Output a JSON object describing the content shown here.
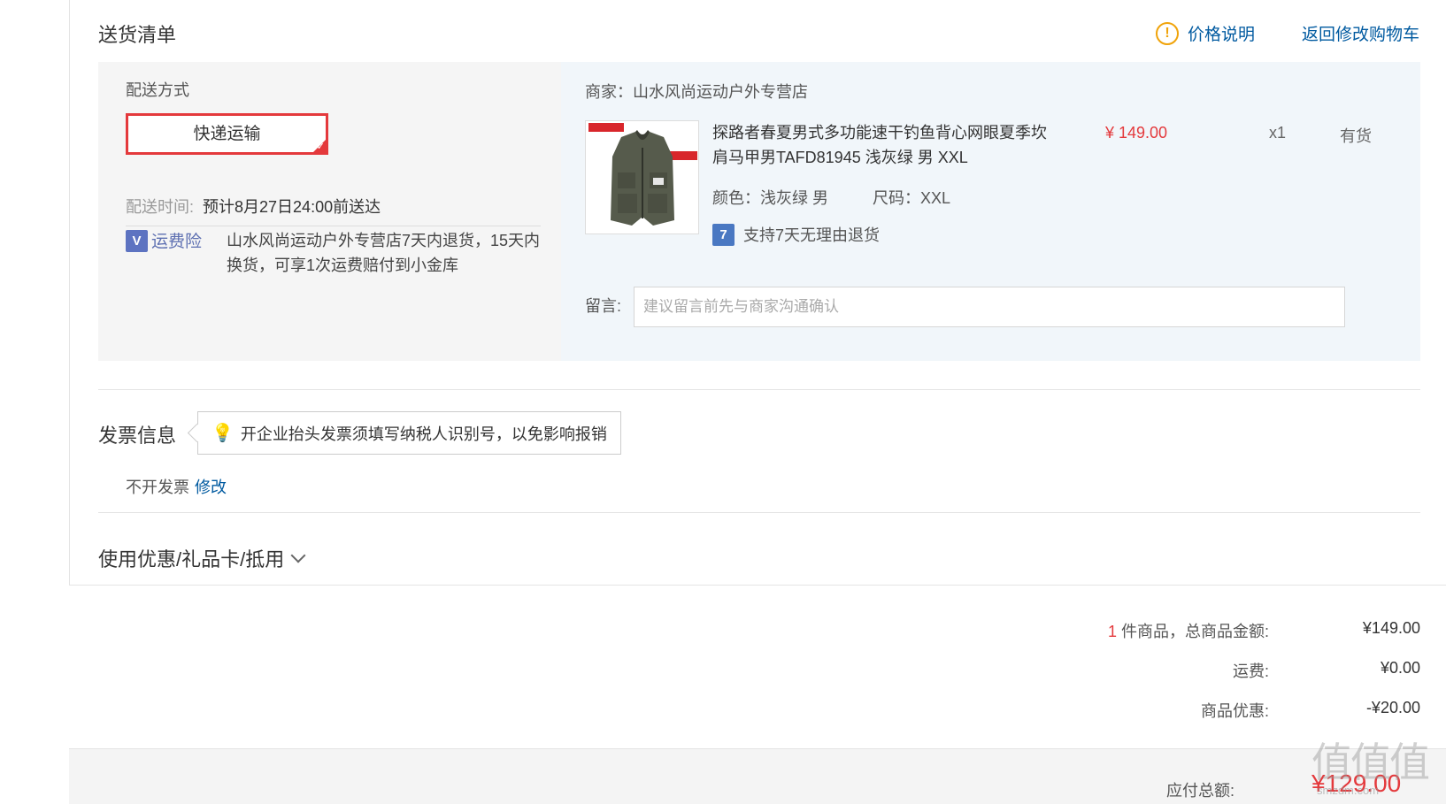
{
  "header": {
    "title": "送货清单",
    "price_note": "价格说明",
    "back_cart": "返回修改购物车"
  },
  "delivery": {
    "method_label": "配送方式",
    "method_selected": "快递运输",
    "time_label": "配送时间:",
    "time_value": "预计8月27日24:00前送达",
    "insurance_label": "运费险",
    "insurance_text": "山水风尚运动户外专营店7天内退货，15天内换货，可享1次运费赔付到小金库"
  },
  "shop": {
    "merchant": "商家：山水风尚运动户外专营店",
    "product": {
      "title": "探路者春夏男式多功能速干钓鱼背心网眼夏季坎肩马甲男TAFD81945 浅灰绿 男 XXL",
      "price": "¥ 149.00",
      "qty": "x1",
      "stock": "有货",
      "color": "颜色：浅灰绿 男",
      "size": "尺码：XXL",
      "return_policy": "支持7天无理由退货"
    },
    "message_label": "留言:",
    "message_placeholder": "建议留言前先与商家沟通确认",
    "message_value": ""
  },
  "invoice": {
    "title": "发票信息",
    "tip": "开企业抬头发票须填写纳税人识别号，以免影响报销",
    "status": "不开发票",
    "edit": "修改"
  },
  "coupon": {
    "label": "使用优惠/礼品卡/抵用"
  },
  "summary": {
    "count": "1",
    "goods_label": "件商品，总商品金额:",
    "goods_value": "¥149.00",
    "shipping_label": "运费:",
    "shipping_value": "¥0.00",
    "discount_label": "商品优惠:",
    "discount_value": "-¥20.00",
    "total_label": "应付总额:",
    "total_value": "¥129.00"
  },
  "watermark": {
    "main": "值值值",
    "sub": "smzdm.com"
  },
  "colors": {
    "accent_red": "#e4393c",
    "link_blue": "#005aa0",
    "warning_orange": "#f0a30a"
  }
}
